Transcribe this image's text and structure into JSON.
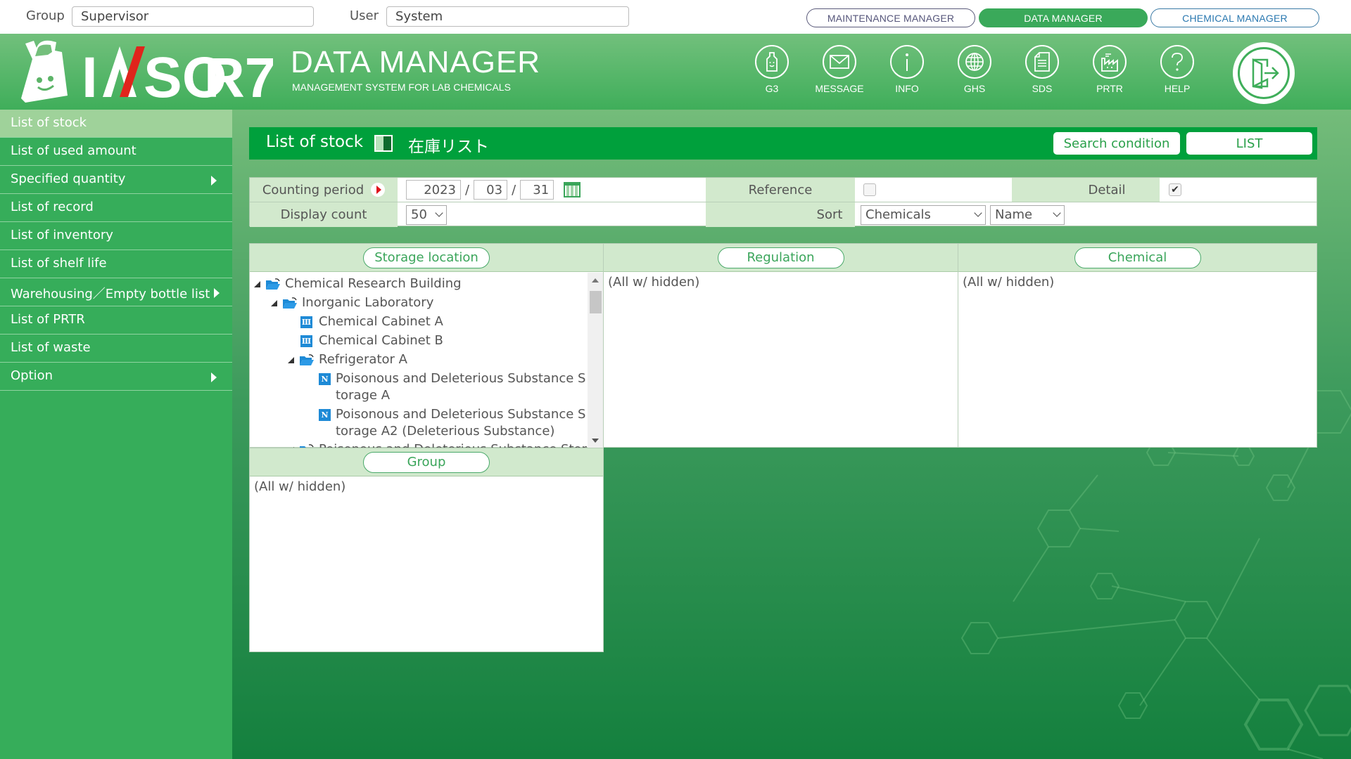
{
  "topbar": {
    "group_label": "Group",
    "group_value": "Supervisor",
    "user_label": "User",
    "user_value": "System",
    "modes": [
      {
        "label": "MAINTENANCE MANAGER",
        "active": false
      },
      {
        "label": "DATA MANAGER",
        "active": true
      },
      {
        "label": "CHEMICAL MANAGER",
        "active": false
      }
    ]
  },
  "header": {
    "logo_text": "IASO R7",
    "app_title": "DATA MANAGER",
    "app_subtitle": "MANAGEMENT SYSTEM FOR LAB CHEMICALS",
    "icons": [
      {
        "label": "G3",
        "icon": "bottle-icon"
      },
      {
        "label": "MESSAGE",
        "icon": "envelope-icon"
      },
      {
        "label": "INFO",
        "icon": "info-icon"
      },
      {
        "label": "GHS",
        "icon": "globe-icon"
      },
      {
        "label": "SDS",
        "icon": "document-icon"
      },
      {
        "label": "PRTR",
        "icon": "factory-icon"
      },
      {
        "label": "HELP",
        "icon": "question-icon"
      }
    ],
    "logout_icon": "logout-door-icon"
  },
  "sidebar": {
    "items": [
      {
        "label": "List of stock",
        "active": true,
        "submenu": false
      },
      {
        "label": "List of used amount",
        "active": false,
        "submenu": false
      },
      {
        "label": "Specified quantity",
        "active": false,
        "submenu": true
      },
      {
        "label": "List of record",
        "active": false,
        "submenu": false
      },
      {
        "label": "List of inventory",
        "active": false,
        "submenu": false
      },
      {
        "label": "List of shelf life",
        "active": false,
        "submenu": false
      },
      {
        "label": "Warehousing／Empty bottle list",
        "active": false,
        "submenu": true
      },
      {
        "label": "List of PRTR",
        "active": false,
        "submenu": false
      },
      {
        "label": "List of waste",
        "active": false,
        "submenu": false
      },
      {
        "label": "Option",
        "active": false,
        "submenu": true
      }
    ]
  },
  "page": {
    "title": "List of stock",
    "title_ja": "在庫リスト",
    "search_condition_label": "Search condition",
    "list_label": "LIST"
  },
  "filters": {
    "counting_period_label": "Counting period",
    "year": "2023",
    "month": "03",
    "day": "31",
    "date_sep": "/",
    "reference_label": "Reference",
    "reference_checked": false,
    "detail_label": "Detail",
    "detail_checked": true,
    "check_mark": "✔",
    "display_count_label": "Display count",
    "display_count_value": "50",
    "sort_label": "Sort",
    "sort_primary": "Chemicals",
    "sort_secondary": "Name"
  },
  "panels": {
    "storage_location": {
      "label": "Storage location",
      "tree": [
        {
          "label": "Chemical Research Building",
          "type": "folder",
          "expanded": true,
          "level": 0
        },
        {
          "label": "Inorganic Laboratory",
          "type": "folder",
          "expanded": true,
          "level": 1
        },
        {
          "label": "Chemical Cabinet A",
          "type": "cabinet",
          "level": 2
        },
        {
          "label": "Chemical Cabinet B",
          "type": "cabinet",
          "level": 2
        },
        {
          "label": "Refrigerator A",
          "type": "folder",
          "expanded": true,
          "level": 2
        },
        {
          "label": "Poisonous and Deleterious Substance S",
          "label2": "torage A",
          "type": "poison",
          "level": 3
        },
        {
          "label": "Poisonous and Deleterious Substance S",
          "label2": "torage A2 (Deleterious Substance)",
          "type": "poison",
          "level": 3
        },
        {
          "label": "Poisonous and Deleterious Substance Stor",
          "type": "folder",
          "expanded": true,
          "level": 2
        }
      ]
    },
    "regulation": {
      "label": "Regulation",
      "value": "(All w/ hidden)"
    },
    "chemical": {
      "label": "Chemical",
      "value": "(All w/ hidden)"
    },
    "group": {
      "label": "Group",
      "value": "(All w/ hidden)"
    }
  },
  "colors": {
    "brand_green": "#3fae5a",
    "title_green": "#00a03c",
    "sidebar_green": "#36ad5a",
    "sidebar_active": "#9fd29a",
    "label_bg": "#d2e9cd",
    "logo_red": "#e0241c"
  }
}
